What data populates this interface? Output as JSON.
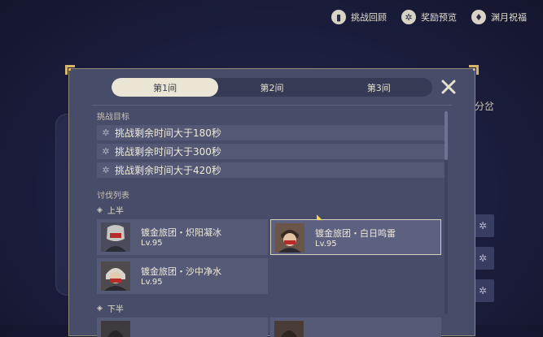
{
  "topnav": [
    {
      "label": "挑战回顾",
      "icon": "book-icon",
      "glyph": "▮"
    },
    {
      "label": "奖励预览",
      "icon": "gift-icon",
      "glyph": "✲"
    },
    {
      "label": "渊月祝福",
      "icon": "moon-blessing-icon",
      "glyph": "♦"
    }
  ],
  "background": {
    "right_label": "分岔"
  },
  "dialog": {
    "tabs": [
      {
        "label": "第1间",
        "active": true
      },
      {
        "label": "第2间",
        "active": false
      },
      {
        "label": "第3间",
        "active": false
      }
    ],
    "goals_title": "挑战目标",
    "goals": [
      "挑战剩余时间大于180秒",
      "挑战剩余时间大于300秒",
      "挑战剩余时间大于420秒"
    ],
    "enemies_title": "讨伐列表",
    "first_half_label": "上半",
    "second_half_label": "下半",
    "enemies_first_half": [
      {
        "name": "镀金旅团・炽阳凝冰",
        "level": "Lv.95",
        "selected": false
      },
      {
        "name": "镀金旅团・白日鸣雷",
        "level": "Lv.95",
        "selected": true
      },
      {
        "name": "镀金旅团・沙中净水",
        "level": "Lv.95",
        "selected": false
      }
    ]
  },
  "colors": {
    "panel": "#474d68",
    "active_tab": "#ebe5d6",
    "gold_border": "#8f8a78"
  }
}
